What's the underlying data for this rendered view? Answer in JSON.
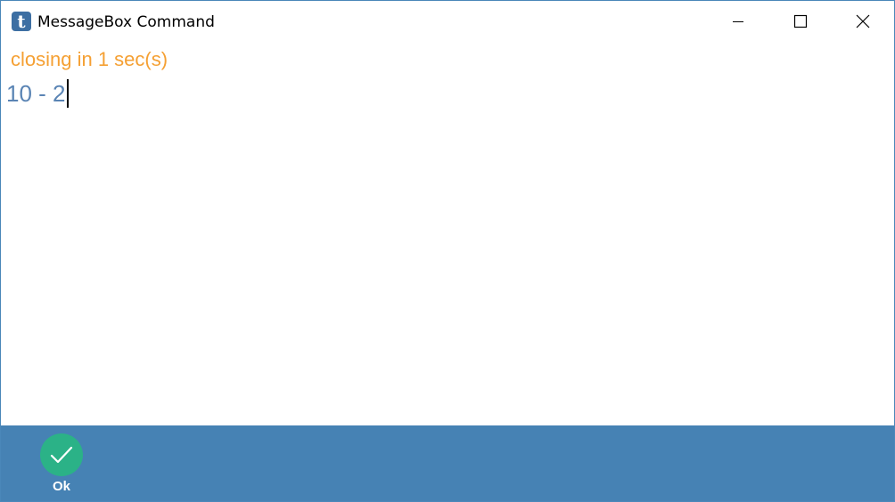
{
  "window": {
    "title": "MessageBox Command",
    "app_icon_letter": "t"
  },
  "content": {
    "status": "closing in 1 sec(s)",
    "expression": "10 - 2"
  },
  "footer": {
    "ok_label": "Ok"
  },
  "colors": {
    "status_text": "#f5a033",
    "expression_text": "#5a84b4",
    "footer_background": "#4682b4",
    "ok_button": "#2bb287",
    "app_icon": "#3d6fa3"
  },
  "icons": {
    "app": "app-logo-icon",
    "minimize": "minimize-icon",
    "maximize": "maximize-icon",
    "close": "close-icon",
    "ok": "checkmark-icon"
  }
}
